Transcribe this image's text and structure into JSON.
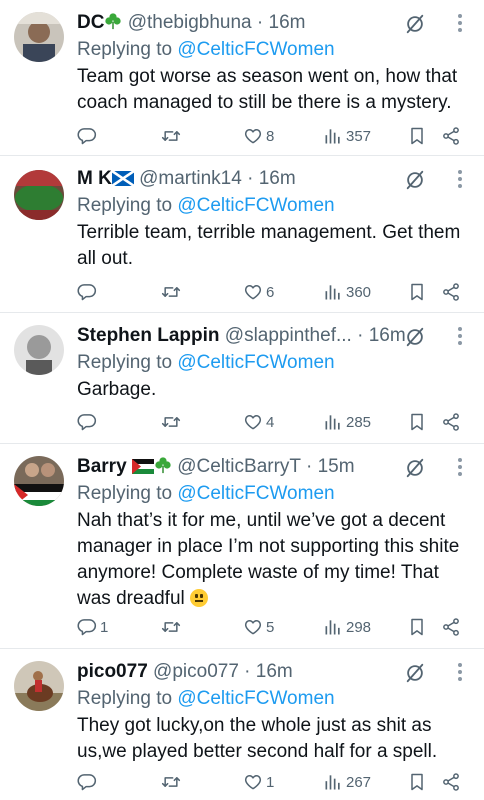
{
  "replies": [
    {
      "name": "DC",
      "name_emoji": "clover",
      "handle": "@thebigbhuna",
      "time": "16m",
      "replying_prefix": "Replying to",
      "mention": "@CelticFCWomen",
      "text": "Team got worse as season went on, how that coach managed to still be there is a mystery.",
      "reply_count": "",
      "retweet_count": "",
      "like_count": "8",
      "view_count": "357"
    },
    {
      "name": "M K",
      "name_emoji": "scotland-flag",
      "handle": "@martink14",
      "time": "16m",
      "replying_prefix": "Replying to",
      "mention": "@CelticFCWomen",
      "text": "Terrible team, terrible management. Get them all out.",
      "reply_count": "",
      "retweet_count": "",
      "like_count": "6",
      "view_count": "360"
    },
    {
      "name": "Stephen Lappin",
      "handle": "@slappinthef...",
      "time": "16m",
      "replying_prefix": "Replying to",
      "mention": "@CelticFCWomen",
      "text": "Garbage.",
      "reply_count": "",
      "retweet_count": "",
      "like_count": "4",
      "view_count": "285"
    },
    {
      "name": "Barry",
      "name_emoji": "palestine-flag-clover",
      "handle": "@CelticBarryT",
      "time": "15m",
      "replying_prefix": "Replying to",
      "mention": "@CelticFCWomen",
      "text": "Nah that’s it for me, until we’ve got a decent manager in place I’m not supporting this shite anymore! Complete waste of my time! That was dreadful",
      "text_emoji": "neutral-face",
      "reply_count": "1",
      "retweet_count": "",
      "like_count": "5",
      "view_count": "298"
    },
    {
      "name": "pico077",
      "handle": "@pico077",
      "time": "16m",
      "replying_prefix": "Replying to",
      "mention": "@CelticFCWomen",
      "text": "They got lucky,on the whole just as shit as us,we played better second half for a spell.",
      "reply_count": "",
      "retweet_count": "",
      "like_count": "1",
      "view_count": "267"
    }
  ],
  "dot": "·",
  "colors": {
    "accent": "#1d9bf0",
    "muted": "#536471",
    "text": "#0f1419"
  }
}
